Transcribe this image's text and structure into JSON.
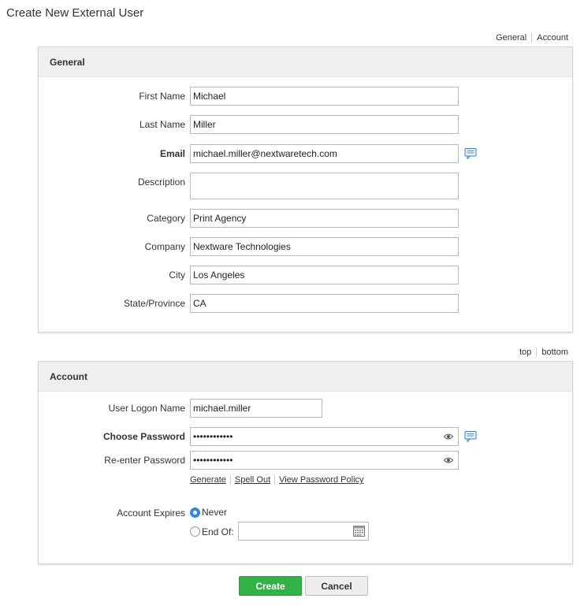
{
  "page": {
    "title": "Create New External User"
  },
  "jump_links_top": [
    "General",
    "Account"
  ],
  "jump_links_mid": [
    "top",
    "bottom"
  ],
  "general": {
    "heading": "General",
    "first_name": {
      "label": "First Name",
      "value": "Michael"
    },
    "last_name": {
      "label": "Last Name",
      "value": "Miller"
    },
    "email": {
      "label": "Email",
      "value": "michael.miller@nextwaretech.com"
    },
    "description": {
      "label": "Description",
      "value": ""
    },
    "category": {
      "label": "Category",
      "value": "Print Agency"
    },
    "company": {
      "label": "Company",
      "value": "Nextware Technologies"
    },
    "city": {
      "label": "City",
      "value": "Los Angeles"
    },
    "state": {
      "label": "State/Province",
      "value": "CA"
    }
  },
  "account": {
    "heading": "Account",
    "logon": {
      "label": "User Logon Name",
      "value": "michael.miller"
    },
    "password": {
      "label": "Choose Password",
      "value": "••••••••••••"
    },
    "reenter": {
      "label": "Re-enter Password",
      "value": "••••••••••••"
    },
    "links": [
      "Generate",
      "Spell Out",
      "View Password Policy"
    ],
    "expires": {
      "label": "Account Expires",
      "never": "Never",
      "end_of": "End Of:",
      "date_value": ""
    }
  },
  "buttons": {
    "create": "Create",
    "cancel": "Cancel"
  },
  "colors": {
    "create_bg": "#33b248",
    "radio_on": "#2f8bd6",
    "section_head_bg": "#efefef"
  }
}
